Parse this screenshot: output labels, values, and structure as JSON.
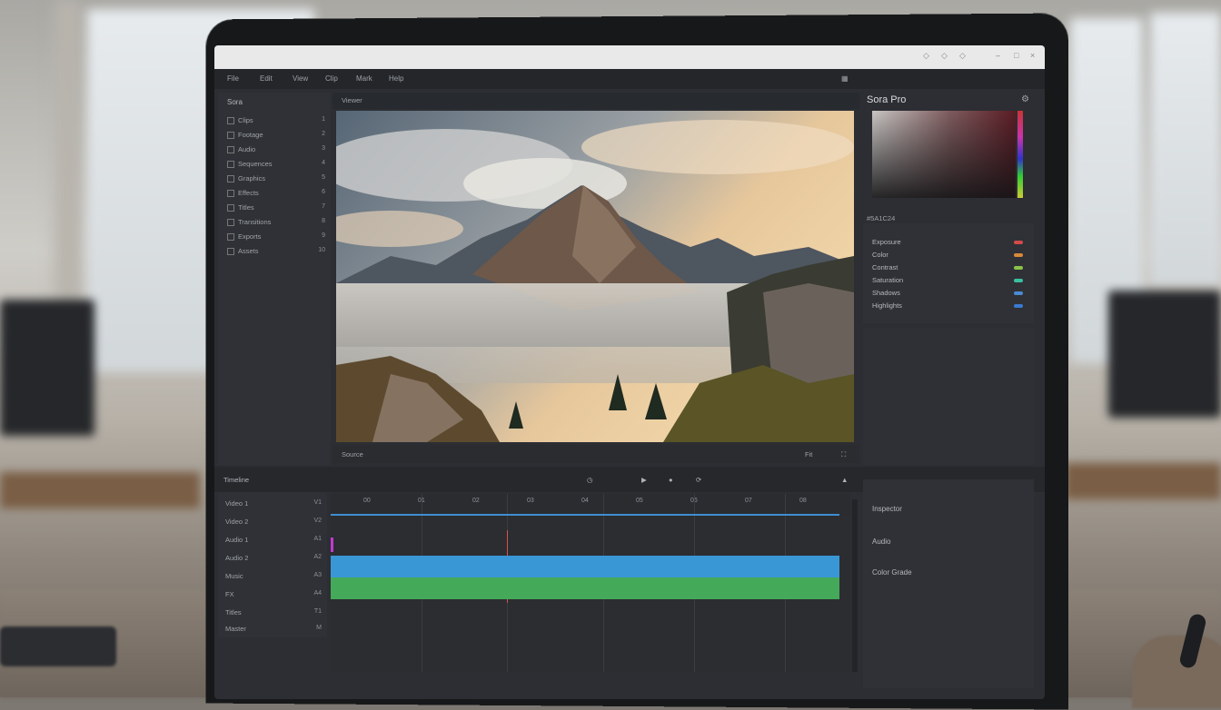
{
  "app": {
    "title": "Sora Pro",
    "menu": [
      "File",
      "Edit",
      "View",
      "Clip",
      "Mark",
      "Help"
    ]
  },
  "left_panel": {
    "header": "Sora",
    "items": [
      {
        "label": "Clips",
        "num": "1"
      },
      {
        "label": "Footage",
        "num": "2"
      },
      {
        "label": "Audio",
        "num": "3"
      },
      {
        "label": "Sequences",
        "num": "4"
      },
      {
        "label": "Graphics",
        "num": "5"
      },
      {
        "label": "Effects",
        "num": "6"
      },
      {
        "label": "Titles",
        "num": "7"
      },
      {
        "label": "Transitions",
        "num": "8"
      },
      {
        "label": "Exports",
        "num": "9"
      },
      {
        "label": "Assets",
        "num": "10"
      }
    ]
  },
  "viewer": {
    "toolbar_text": "Viewer",
    "footer_left": "Source",
    "footer_right": "Fit"
  },
  "right_panel": {
    "color_value": "#5A1C24",
    "layers": [
      {
        "label": "Exposure",
        "color": "#d24a4a"
      },
      {
        "label": "Color",
        "color": "#d88a3a"
      },
      {
        "label": "Contrast",
        "color": "#8ac24a"
      },
      {
        "label": "Saturation",
        "color": "#3abfa0"
      },
      {
        "label": "Shadows",
        "color": "#4a8ad2"
      },
      {
        "label": "Highlights",
        "color": "#3a7ad2"
      }
    ],
    "bottom_title": "Inspector",
    "bottom_rows": [
      "Audio",
      "Color Grade"
    ]
  },
  "timeline": {
    "label": "Timeline",
    "tracks": [
      {
        "label": "Video 1",
        "num": "V1"
      },
      {
        "label": "Video 2",
        "num": "V2"
      },
      {
        "label": "Audio 1",
        "num": "A1"
      },
      {
        "label": "Audio 2",
        "num": "A2"
      },
      {
        "label": "Music",
        "num": "A3"
      },
      {
        "label": "FX",
        "num": "A4"
      },
      {
        "label": "Titles",
        "num": "T1"
      },
      {
        "label": "Master",
        "num": "M"
      }
    ],
    "ruler_marks": [
      "00",
      "01",
      "02",
      "03",
      "04",
      "05",
      "06",
      "07",
      "08"
    ]
  }
}
